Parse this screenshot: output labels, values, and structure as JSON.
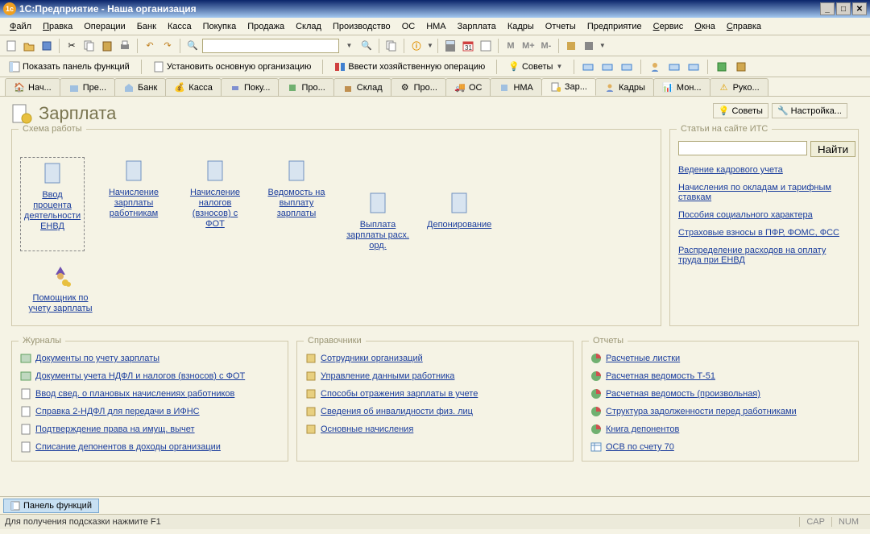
{
  "window": {
    "title": "1С:Предприятие - Наша организация"
  },
  "menu": [
    "Файл",
    "Правка",
    "Операции",
    "Банк",
    "Касса",
    "Покупка",
    "Продажа",
    "Склад",
    "Производство",
    "ОС",
    "НМА",
    "Зарплата",
    "Кадры",
    "Отчеты",
    "Предприятие",
    "Сервис",
    "Окна",
    "Справка"
  ],
  "menu_underline": [
    "Ф",
    "П",
    "",
    "",
    "",
    "",
    "",
    "",
    "",
    "",
    "",
    "",
    "",
    "",
    "",
    "С",
    "О",
    "С"
  ],
  "toolbar1": {
    "search_placeholder": ""
  },
  "toolbar2": {
    "show_panel": "Показать панель функций",
    "set_org": "Установить основную организацию",
    "enter_op": "Ввести хозяйственную операцию",
    "tips": "Советы"
  },
  "tabs": [
    "Нач...",
    "Пре...",
    "Банк",
    "Касса",
    "Поку...",
    "Про...",
    "Склад",
    "Про...",
    "ОС",
    "НМА",
    "Зар...",
    "Кадры",
    "Мон...",
    "Руко..."
  ],
  "page": {
    "title": "Зарплата",
    "tips": "Советы",
    "settings": "Настройка..."
  },
  "scheme": {
    "legend": "Схема работы",
    "items": [
      "Ввод процента деятельности ЕНВД",
      "Начисление зарплаты работникам",
      "Начисление налогов (взносов) с ФОТ",
      "Ведомость на выплату зарплаты",
      "Выплата зарплаты расх. орд.",
      "Депонирование"
    ],
    "helper": "Помощник по учету зарплаты"
  },
  "its": {
    "legend": "Статьи на сайте ИТС",
    "find": "Найти",
    "links": [
      "Ведение кадрового учета",
      "Начисления по окладам и тарифным ставкам",
      "Пособия социального характера",
      "Страховые взносы в ПФР, ФОМС, ФСС",
      "Распределение расходов на оплату труда при ЕНВД"
    ]
  },
  "journals": {
    "legend": "Журналы",
    "links": [
      "Документы по учету зарплаты",
      "Документы учета НДФЛ и налогов (взносов) с ФОТ",
      "Ввод свед. о плановых начислениях работников",
      "Справка 2-НДФЛ для передачи в ИФНС",
      "Подтверждение права на имущ. вычет",
      "Списание депонентов в доходы организации"
    ]
  },
  "refs": {
    "legend": "Справочники",
    "links": [
      "Сотрудники организаций",
      "Управление данными работника",
      "Способы отражения зарплаты в учете",
      "Сведения об инвалидности физ. лиц",
      "Основные начисления"
    ]
  },
  "reports": {
    "legend": "Отчеты",
    "links": [
      "Расчетные листки",
      "Расчетная ведомость Т-51",
      "Расчетная ведомость (произвольная)",
      "Структура задолженности перед работниками",
      "Книга депонентов",
      "ОСВ по счету 70"
    ]
  },
  "bottom": {
    "panel_functions": "Панель функций",
    "hint": "Для получения подсказки нажмите F1",
    "cap": "CAP",
    "num": "NUM"
  }
}
